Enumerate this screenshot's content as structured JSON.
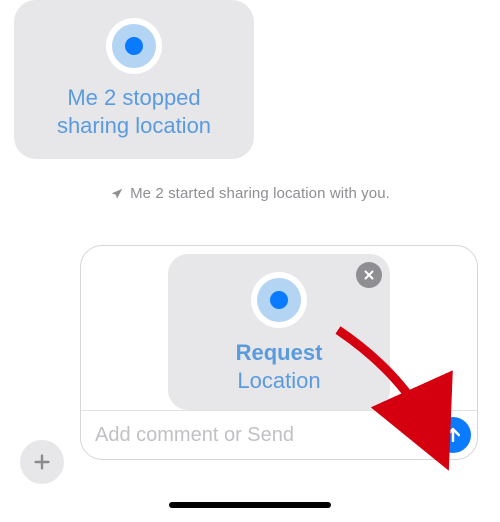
{
  "conversation": {
    "incoming_bubble": {
      "text": "Me 2 stopped sharing location"
    },
    "system_status": {
      "text": "Me 2 started sharing location with you."
    }
  },
  "compose": {
    "attachment": {
      "title": "Request",
      "subtitle": "Location"
    },
    "placeholder": "Add comment or Send"
  },
  "colors": {
    "accent_blue": "#0a7aff",
    "link_blue": "#5a9be0",
    "bubble_gray": "#e7e7e9",
    "system_gray": "#8e8e93"
  }
}
